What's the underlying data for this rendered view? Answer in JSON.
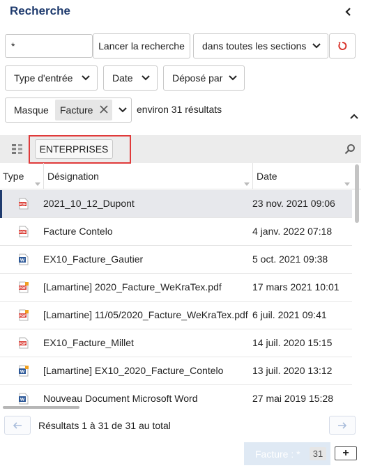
{
  "panel": {
    "title": "Recherche"
  },
  "search": {
    "value": "*",
    "submit_label": "Lancer la recherche",
    "scope_value": "dans toutes les sections"
  },
  "filters": {
    "entry_type": "Type d'entrée",
    "date": "Date",
    "deposited_by": "Déposé par",
    "mask_label": "Masque",
    "mask_chip": "Facture"
  },
  "results": {
    "count_text": "environ 31 résultats",
    "folder_button": "ENTERPRISES",
    "columns": {
      "type": "Type",
      "name": "Désignation",
      "date": "Date"
    },
    "rows": [
      {
        "icon": "pdf-file-icon",
        "name": "2021_10_12_Dupont",
        "date": "23 nov. 2021 09:06",
        "selected": true
      },
      {
        "icon": "pdf-file-icon",
        "name": "Facture Contelo",
        "date": "4 janv. 2022 07:18"
      },
      {
        "icon": "word-file-icon",
        "name": "EX10_Facture_Gautier",
        "date": "5 oct. 2021 09:38"
      },
      {
        "icon": "pdf-linked-file-icon",
        "name": "[Lamartine] 2020_Facture_WeKraTex.pdf",
        "date": "17 mars 2021 10:01"
      },
      {
        "icon": "pdf-linked-file-icon",
        "name": "[Lamartine] 11/05/2020_Facture_WeKraTex.pdf",
        "date": "6 juil. 2021 09:41"
      },
      {
        "icon": "pdf-file-icon",
        "name": "EX10_Facture_Millet",
        "date": "14 juil. 2020 15:15"
      },
      {
        "icon": "word-linked-file-icon",
        "name": "[Lamartine] EX10_2020_Facture_Contelo",
        "date": "13 juil. 2020 13:12"
      },
      {
        "icon": "word-file-icon",
        "name": "Nouveau Document Microsoft Word",
        "date": "27 mai 2019 15:28"
      }
    ],
    "pagination_text": "Résultats 1 à 31 de 31 au total"
  },
  "bottom_tab": {
    "label": "Facture : *",
    "count": "31"
  },
  "colors": {
    "title": "#1f3b6e",
    "highlight": "#e03a3a",
    "reset": "#d9372f",
    "selected_row": "#e7e8ec"
  }
}
